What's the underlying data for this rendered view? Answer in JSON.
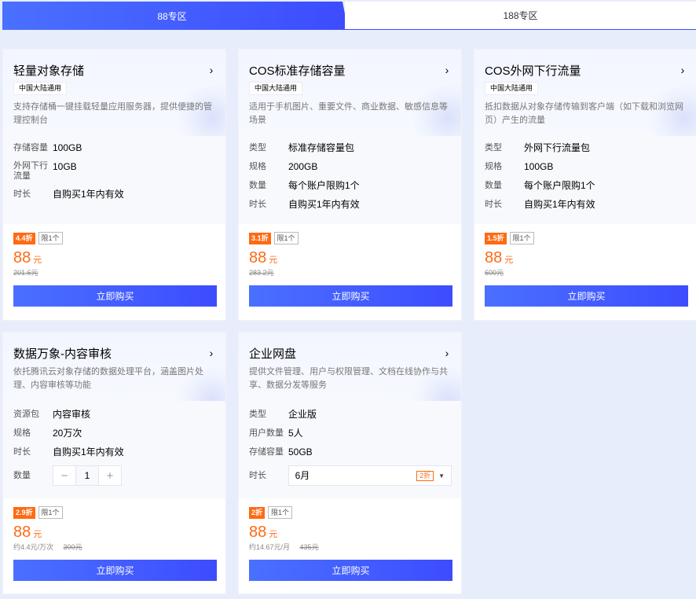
{
  "tabs": [
    {
      "label": "88专区"
    },
    {
      "label": "188专区"
    }
  ],
  "colors": {
    "accent": "#3d4cff",
    "discount": "#ff6a13"
  },
  "buy_label": "立即购买",
  "cards": [
    {
      "title": "轻量对象存储",
      "tag": "中国大陆通用",
      "desc": "支持存储桶一键挂载轻量应用服务器，提供便捷的管理控制台",
      "specs": [
        {
          "label": "存储容量",
          "value": "100GB"
        },
        {
          "label": "外网下行流量",
          "value": "10GB"
        },
        {
          "label": "时长",
          "value": "自购买1年内有效"
        }
      ],
      "discount": "4.4折",
      "limit": "限1个",
      "price": "88",
      "unit": "元",
      "original": "201.6元"
    },
    {
      "title": "COS标准存储容量",
      "tag": "中国大陆通用",
      "desc": "适用于手机图片、重要文件、商业数据、敏感信息等场景",
      "specs": [
        {
          "label": "类型",
          "value": "标准存储容量包"
        },
        {
          "label": "规格",
          "value": "200GB"
        },
        {
          "label": "数量",
          "value": "每个账户限购1个"
        },
        {
          "label": "时长",
          "value": "自购买1年内有效"
        }
      ],
      "discount": "3.1折",
      "limit": "限1个",
      "price": "88",
      "unit": "元",
      "original": "283.2元"
    },
    {
      "title": "COS外网下行流量",
      "tag": "中国大陆通用",
      "desc": "抵扣数据从对象存储传输到客户端（如下载和浏览网页）产生的流量",
      "specs": [
        {
          "label": "类型",
          "value": "外网下行流量包"
        },
        {
          "label": "规格",
          "value": "100GB"
        },
        {
          "label": "数量",
          "value": "每个账户限购1个"
        },
        {
          "label": "时长",
          "value": "自购买1年内有效"
        }
      ],
      "discount": "1.5折",
      "limit": "限1个",
      "price": "88",
      "unit": "元",
      "original": "600元"
    },
    {
      "title": "数据万象-内容审核",
      "desc": "依托腾讯云对象存储的数据处理平台，涵盖图片处理、内容审核等功能",
      "specs": [
        {
          "label": "资源包",
          "value": "内容审核"
        },
        {
          "label": "规格",
          "value": "20万次"
        },
        {
          "label": "时长",
          "value": "自购买1年内有效"
        }
      ],
      "quantity_label": "数量",
      "quantity": "1",
      "discount": "2.9折",
      "limit": "限1个",
      "price": "88",
      "unit": "元",
      "per_unit": "约4.4元/万次",
      "original": "300元"
    },
    {
      "title": "企业网盘",
      "desc": "提供文件管理、用户与权限管理、文档在线协作与共享、数据分发等服务",
      "specs": [
        {
          "label": "类型",
          "value": "企业版"
        },
        {
          "label": "用户数量",
          "value": "5人"
        },
        {
          "label": "存储容量",
          "value": "50GB"
        }
      ],
      "duration_label": "时长",
      "duration_value": "6月",
      "duration_discount": "2折",
      "discount": "2折",
      "limit": "限1个",
      "price": "88",
      "unit": "元",
      "per_unit": "约14.67元/月",
      "original": "435元"
    }
  ]
}
